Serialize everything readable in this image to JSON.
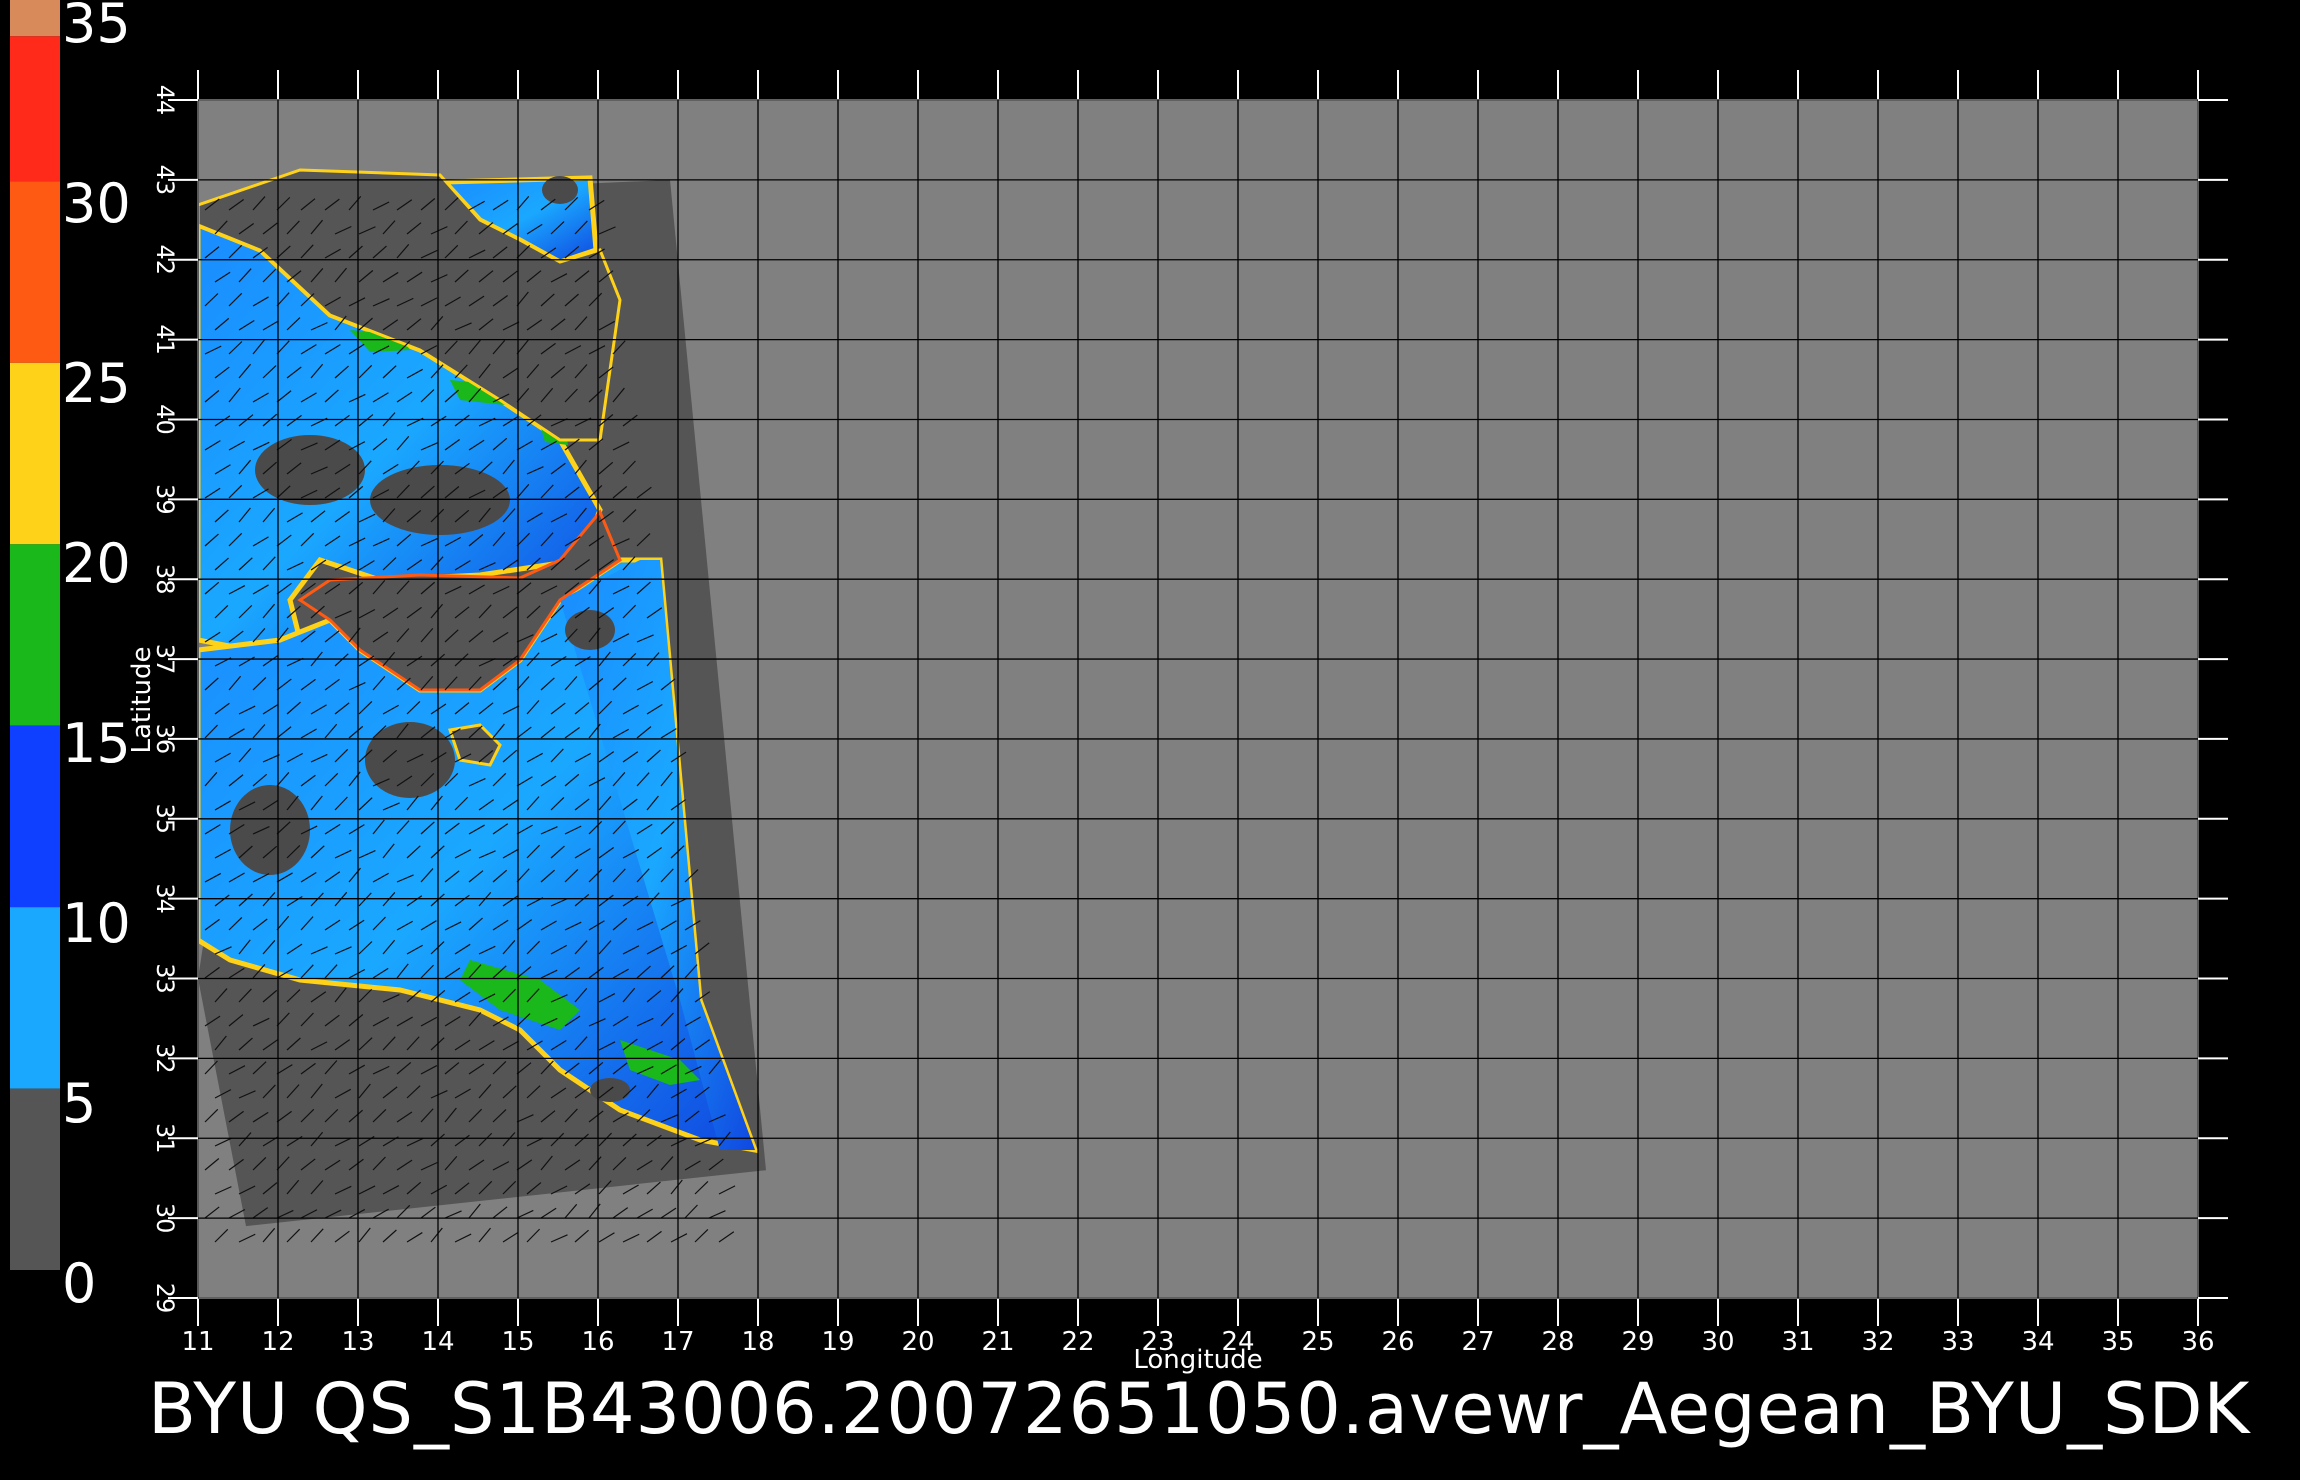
{
  "colorbar": {
    "labels": [
      "35",
      "30",
      "25",
      "20",
      "15",
      "10",
      "5",
      "0"
    ],
    "bands": [
      {
        "from": 35,
        "to": 34,
        "color": "#d98a5a"
      },
      {
        "from": 34,
        "to": 30,
        "color": "#ff2a1a"
      },
      {
        "from": 30,
        "to": 25,
        "color": "#ff5a14"
      },
      {
        "from": 25,
        "to": 20,
        "color": "#ffd21a"
      },
      {
        "from": 20,
        "to": 15,
        "color": "#1ab81a"
      },
      {
        "from": 15,
        "to": 10,
        "color": "#1040ff"
      },
      {
        "from": 10,
        "to": 5,
        "color": "#1aa8ff"
      },
      {
        "from": 5,
        "to": 0,
        "color": "#555555"
      }
    ]
  },
  "map": {
    "lon_range": [
      11,
      36
    ],
    "lat_range": [
      29,
      44
    ],
    "x_label": "Longitude",
    "y_label": "Latitude",
    "x_ticks": [
      "11",
      "12",
      "13",
      "14",
      "15",
      "16",
      "17",
      "18",
      "19",
      "20",
      "21",
      "22",
      "23",
      "24",
      "25",
      "26",
      "27",
      "28",
      "29",
      "30",
      "31",
      "32",
      "33",
      "34",
      "35",
      "36"
    ],
    "y_ticks": [
      "29",
      "30",
      "31",
      "32",
      "33",
      "34",
      "35",
      "36",
      "37",
      "38",
      "39",
      "40",
      "41",
      "42",
      "43",
      "44"
    ],
    "background_color": "#808080",
    "swath_color": "#555555",
    "land_color": "#4a4a4a",
    "swath_corners": [
      [
        12.5,
        42.8
      ],
      [
        16.9,
        43.0
      ],
      [
        18.1,
        30.6
      ],
      [
        11.6,
        29.9
      ],
      [
        11.0,
        33.0
      ]
    ]
  },
  "caption": "BYU QS_S1B43006.20072651050.avewr_Aegean_BYU_SDK"
}
